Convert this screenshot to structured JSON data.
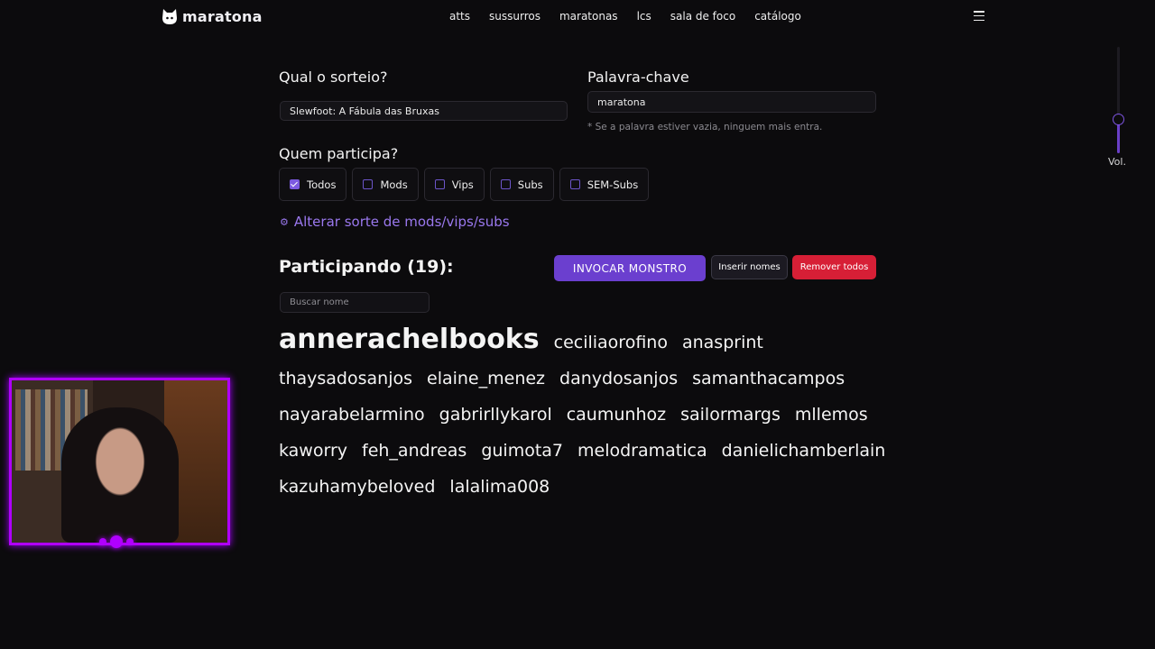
{
  "brand": {
    "name": "maratona"
  },
  "nav": {
    "items": [
      "atts",
      "sussurros",
      "maratonas",
      "lcs",
      "sala de foco",
      "catálogo"
    ]
  },
  "volume": {
    "label": "Vol.",
    "level": 0.33
  },
  "raffle": {
    "title": "Qual o sorteio?",
    "value": "Slewfoot: A Fábula das Bruxas"
  },
  "keyword": {
    "title": "Palavra-chave",
    "value": "maratona",
    "hint": "* Se a palavra estiver vazia, ninguem mais entra."
  },
  "who": {
    "title": "Quem participa?",
    "options": [
      {
        "label": "Todos",
        "checked": true
      },
      {
        "label": "Mods",
        "checked": false
      },
      {
        "label": "Vips",
        "checked": false
      },
      {
        "label": "Subs",
        "checked": false
      },
      {
        "label": "SEM-Subs",
        "checked": false
      }
    ]
  },
  "luck_link": {
    "icon": "gear-icon",
    "label": "Alterar sorte de mods/vips/subs"
  },
  "participants": {
    "title": "Participando (19):",
    "summon_label": "INVOCAR MONSTRO",
    "insert_label": "Inserir nomes",
    "remove_label": "Remover todos",
    "search_placeholder": "Buscar nome",
    "names": [
      "annerachelbooks",
      "ceciliaorofino",
      "anasprint",
      "thaysadosanjos",
      "elaine_menez",
      "danydosanjos",
      "samanthacampos",
      "nayarabelarmino",
      "gabrirllykarol",
      "caumunhoz",
      "sailormargs",
      "mllemos",
      "kaworry",
      "feh_andreas",
      "guimota7",
      "melodramatica",
      "danielichamberlain",
      "kazuhamybeloved",
      "lalalima008"
    ]
  },
  "colors": {
    "accent": "#6b3fcf",
    "danger": "#d71f36",
    "webcam_frame": "#b000ff"
  }
}
